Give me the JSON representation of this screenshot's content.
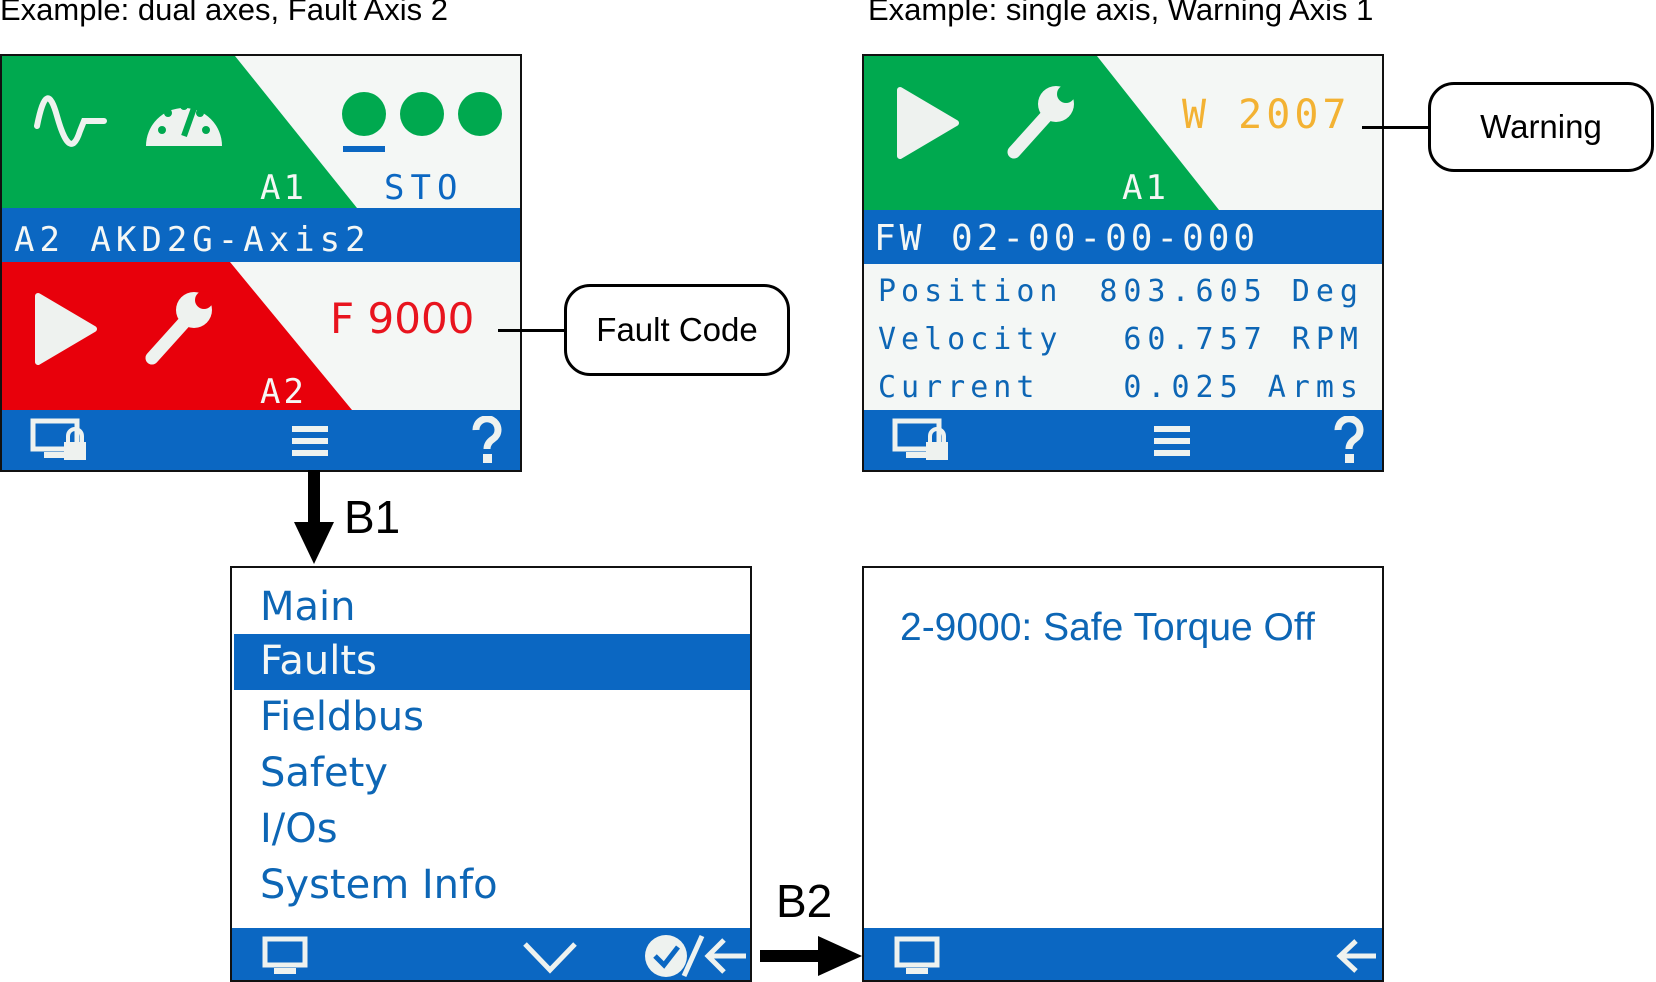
{
  "captions": {
    "left": "Example:  dual axes, Fault Axis 2",
    "right": "Example: single axis, Warning Axis 1"
  },
  "dual_screen": {
    "axis1_label": "A1",
    "sto_label": "STO",
    "axis2_bar": "A2 AKD2G-Axis2",
    "axis2_label": "A2",
    "fault_code": "F 9000",
    "colors": {
      "green": "#00a94f",
      "red": "#e8000b",
      "blue": "#0b67c2",
      "fault_text": "#e8141e"
    }
  },
  "single_screen": {
    "axis1_label": "A1",
    "warning_code": "W 2007",
    "fw_bar": "FW 02-00-00-000",
    "rows": [
      {
        "label": "Position",
        "value": "803.605 Deg"
      },
      {
        "label": "Velocity",
        "value": "60.757 RPM"
      },
      {
        "label": "Current",
        "value": "0.025 Arms"
      }
    ],
    "colors": {
      "warning_text": "#f3b233"
    }
  },
  "callouts": {
    "fault": "Fault Code",
    "warning": "Warning"
  },
  "arrows": {
    "b1": "B1",
    "b2": "B2"
  },
  "menu_screen": {
    "items": [
      "Main",
      "Faults",
      "Fieldbus",
      "Safety",
      "I/Os",
      "System Info"
    ],
    "selected_index": 1
  },
  "fault_detail_screen": {
    "message": "2-9000: Safe Torque Off"
  },
  "icons": [
    "waveform-icon",
    "gauge-icon",
    "status-dots-icon",
    "play-icon",
    "wrench-icon",
    "monitor-lock-icon",
    "menu-icon",
    "help-icon",
    "monitor-icon",
    "chevron-down-icon",
    "confirm-back-icon",
    "back-arrow-icon"
  ]
}
